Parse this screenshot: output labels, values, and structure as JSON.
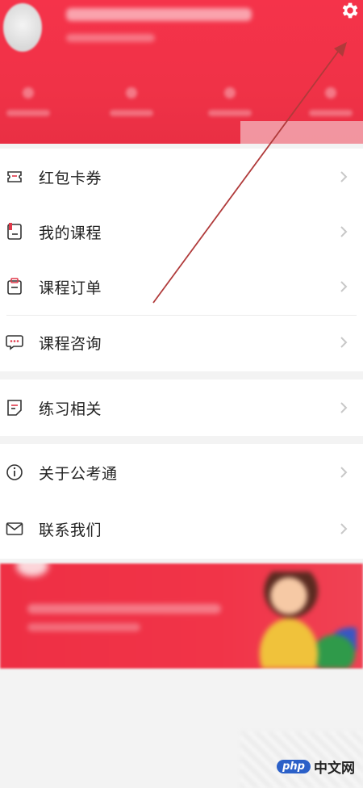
{
  "menu": {
    "group1": [
      {
        "label": "红包卡券",
        "icon": "ticket-icon"
      },
      {
        "label": "我的课程",
        "icon": "course-book-icon"
      },
      {
        "label": "课程订单",
        "icon": "clipboard-order-icon"
      },
      {
        "label": "课程咨询",
        "icon": "chat-bubble-icon"
      }
    ],
    "group2": [
      {
        "label": "练习相关",
        "icon": "practice-note-icon"
      }
    ],
    "group3": [
      {
        "label": "关于公考通",
        "icon": "info-circle-icon"
      },
      {
        "label": "联系我们",
        "icon": "envelope-icon"
      }
    ]
  },
  "header": {
    "settings_icon": "gear-icon"
  },
  "watermark": {
    "logo": "php",
    "site": "中文网"
  },
  "colors": {
    "brand_red": "#f03247",
    "icon_red": "#e0394a",
    "text": "#222222",
    "chevron": "#c8c8c8"
  }
}
